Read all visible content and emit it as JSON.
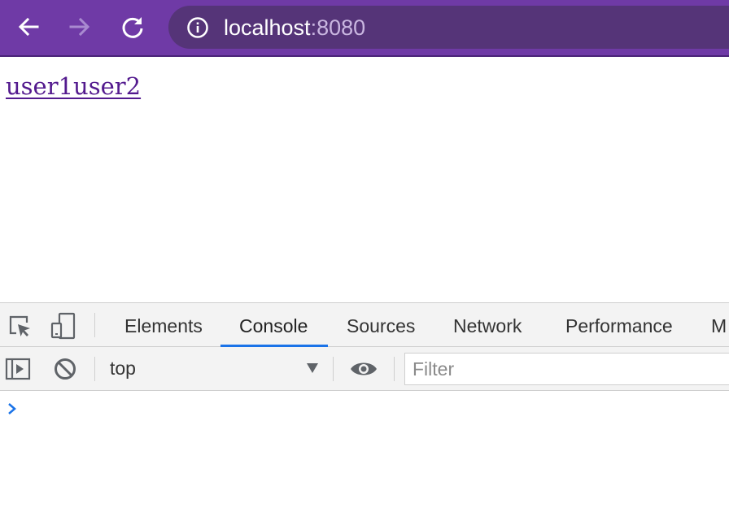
{
  "browser": {
    "url_host": "localhost",
    "url_port": ":8080",
    "icons": {
      "back": "arrow-left-icon",
      "forward": "arrow-right-icon",
      "reload": "reload-icon",
      "info": "info-icon"
    },
    "colors": {
      "toolbar": "#6f3aa6",
      "omnibox": "#553478"
    }
  },
  "page": {
    "link_text": "user1user2",
    "link_color": "#531a8e"
  },
  "devtools": {
    "tabs": [
      {
        "label": "Elements"
      },
      {
        "label": "Console"
      },
      {
        "label": "Sources"
      },
      {
        "label": "Network"
      },
      {
        "label": "Performance"
      },
      {
        "label": "M"
      }
    ],
    "active_tab": "Console",
    "accent_color": "#1a73e8",
    "console": {
      "context": "top",
      "filter_placeholder": "Filter",
      "filter_value": ""
    }
  }
}
